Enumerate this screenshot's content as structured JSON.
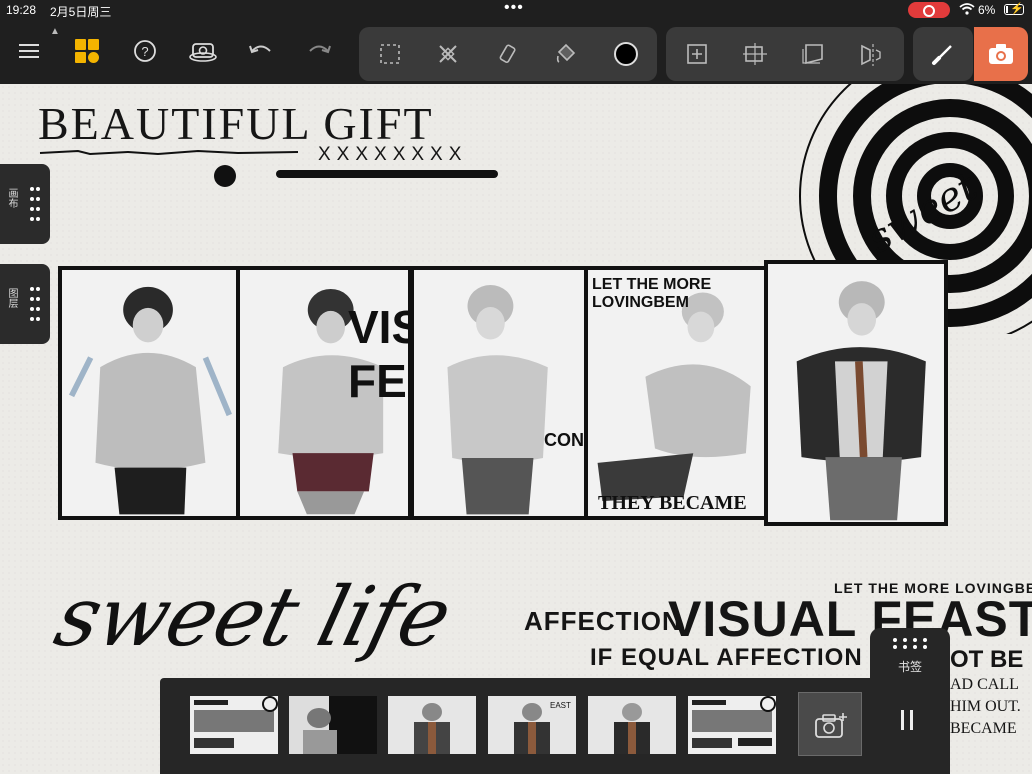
{
  "status_bar": {
    "time": "19:28",
    "date": "2月5日周三",
    "battery": "6%"
  },
  "toolbar": {
    "menu_icon": "hamburger-icon",
    "gallery_icon": "gallery-grid-icon",
    "help_icon": "help-icon",
    "reference_icon": "reference-camera-icon",
    "undo_icon": "undo-icon",
    "redo_icon": "redo-icon",
    "tools": [
      "selection-icon",
      "transform-icon",
      "eraser-icon",
      "fill-bucket-icon",
      "color-icon"
    ],
    "layer_tools": [
      "add-layer-icon",
      "align-icon",
      "perspective-icon",
      "symmetry-icon"
    ],
    "brush_icon": "brush-icon",
    "camera_icon": "camera-icon",
    "accent": "#e8704a"
  },
  "side_tabs": {
    "canvas_label": "画布",
    "layer_label": "图层"
  },
  "artwork": {
    "title": "BEAUTIFUL GIFT",
    "xs": "XXXXXXXX",
    "swirl_text": "sweet",
    "panel_words": [
      "VISUAL FEAST",
      "LET THE MORE LOVINGBEM",
      "AFFECTION",
      "CONSTITUTION",
      "THEY BECAME"
    ],
    "script": "sweet life",
    "poster": {
      "line1": "LET THE MORE  LOVINGBEM",
      "line2a": "AFFECTION",
      "line2b": "VISUAL FEAST",
      "line3a": "IF EQUAL AFFECTION",
      "line3b": "OT BE",
      "line4": "AD CALL",
      "line5": "HIM OUT.",
      "line6": "BECAME"
    }
  },
  "bookmark": {
    "label": "书签"
  },
  "filmstrip": {
    "thumb_count": 6,
    "add_icon": "add-snapshot-icon",
    "pause_icon": "pause-icon"
  }
}
